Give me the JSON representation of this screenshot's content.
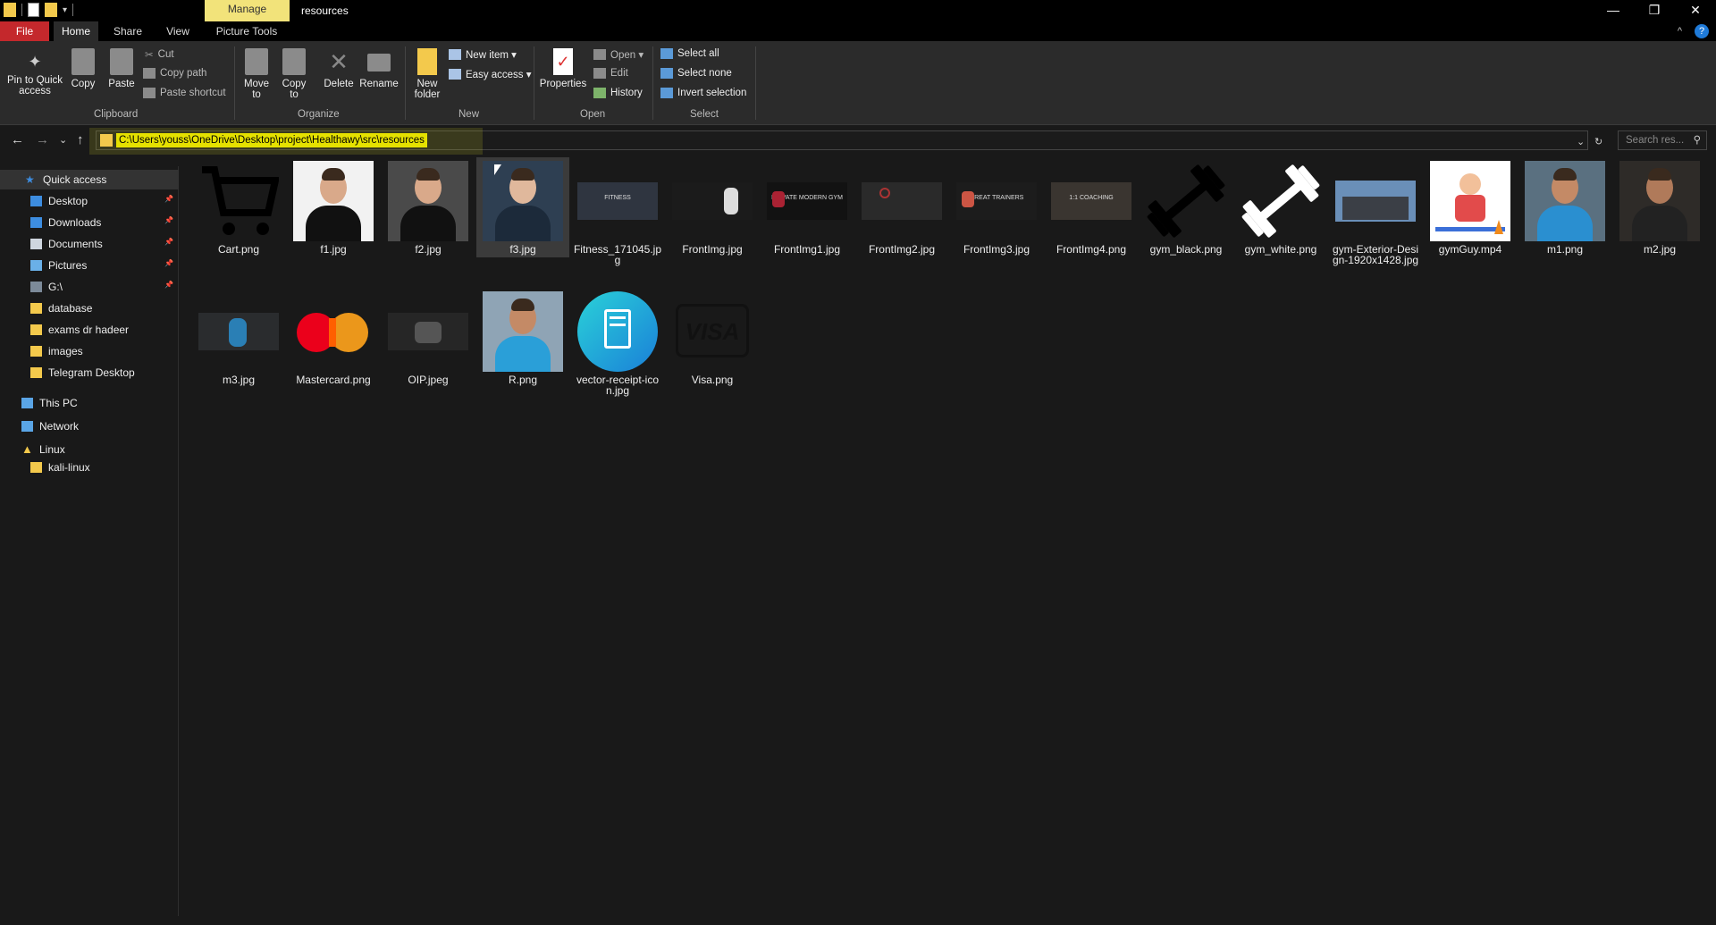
{
  "titlebar": {
    "manage_tab": "Manage",
    "title": "resources",
    "minimize": "—",
    "restore": "❐",
    "close": "✕"
  },
  "tabs": {
    "file": "File",
    "home": "Home",
    "share": "Share",
    "view": "View",
    "picture_tools": "Picture Tools",
    "expand": "^",
    "help": "?"
  },
  "ribbon": {
    "pin_quick_access": "Pin to Quick access",
    "copy": "Copy",
    "paste": "Paste",
    "cut": "Cut",
    "copy_path": "Copy path",
    "paste_shortcut": "Paste shortcut",
    "clipboard_label": "Clipboard",
    "move_to": "Move to",
    "copy_to": "Copy to",
    "delete": "Delete",
    "rename": "Rename",
    "organize_label": "Organize",
    "new_folder": "New folder",
    "new_item": "New item ▾",
    "easy_access": "Easy access ▾",
    "new_label": "New",
    "properties": "Properties",
    "open": "Open ▾",
    "edit": "Edit",
    "history": "History",
    "open_label": "Open",
    "select_all": "Select all",
    "select_none": "Select none",
    "invert_selection": "Invert selection",
    "select_label": "Select"
  },
  "address": {
    "back": "←",
    "forward": "→",
    "recent": "⌄",
    "up": "↑",
    "path": "C:\\Users\\youss\\OneDrive\\Desktop\\project\\Healthawy\\src\\resources",
    "dropdown": "⌄",
    "refresh": "↻",
    "search_placeholder": "Search res...",
    "search_icon": "⚲"
  },
  "sidebar": {
    "quick_access": "Quick access",
    "items": [
      {
        "label": "Desktop",
        "icon": "desktop-icon",
        "color": "#3d8de0",
        "pinned": true
      },
      {
        "label": "Downloads",
        "icon": "downloads-icon",
        "color": "#3d8de0",
        "pinned": true
      },
      {
        "label": "Documents",
        "icon": "documents-icon",
        "color": "#cfd6df",
        "pinned": true
      },
      {
        "label": "Pictures",
        "icon": "pictures-icon",
        "color": "#6ab0e8",
        "pinned": true
      },
      {
        "label": "G:\\",
        "icon": "drive-icon",
        "color": "#7c8a99",
        "pinned": true
      },
      {
        "label": "database",
        "icon": "folder-icon",
        "color": "#f3c94c",
        "pinned": false
      },
      {
        "label": "exams dr hadeer",
        "icon": "folder-icon",
        "color": "#f3c94c",
        "pinned": false
      },
      {
        "label": "images",
        "icon": "folder-icon",
        "color": "#f3c94c",
        "pinned": false
      },
      {
        "label": "Telegram Desktop",
        "icon": "folder-icon",
        "color": "#f3c94c",
        "pinned": false
      }
    ],
    "this_pc": "This PC",
    "network": "Network",
    "linux": "Linux",
    "kali": "kali-linux",
    "pin_glyph": "📌"
  },
  "files": [
    {
      "name": "Cart.png",
      "thumb": "cart"
    },
    {
      "name": "f1.jpg",
      "thumb": "f1"
    },
    {
      "name": "f2.jpg",
      "thumb": "f2"
    },
    {
      "name": "f3.jpg",
      "thumb": "f3",
      "selected": true
    },
    {
      "name": "Fitness_171045.jpg",
      "thumb": "fitness"
    },
    {
      "name": "FrontImg.jpg",
      "thumb": "front"
    },
    {
      "name": "FrontImg1.jpg",
      "thumb": "front1"
    },
    {
      "name": "FrontImg2.jpg",
      "thumb": "front2"
    },
    {
      "name": "FrontImg3.jpg",
      "thumb": "front3"
    },
    {
      "name": "FrontImg4.png",
      "thumb": "front4"
    },
    {
      "name": "gym_black.png",
      "thumb": "gymblack"
    },
    {
      "name": "gym_white.png",
      "thumb": "gymwhite"
    },
    {
      "name": "gym-Exterior-Design-1920x1428.jpg",
      "thumb": "exterior"
    },
    {
      "name": "gymGuy.mp4",
      "thumb": "gymguy"
    },
    {
      "name": "m1.png",
      "thumb": "m1"
    },
    {
      "name": "m2.jpg",
      "thumb": "m2"
    },
    {
      "name": "m3.jpg",
      "thumb": "m3"
    },
    {
      "name": "Mastercard.png",
      "thumb": "mastercard"
    },
    {
      "name": "OIP.jpeg",
      "thumb": "oip"
    },
    {
      "name": "R.png",
      "thumb": "r"
    },
    {
      "name": "vector-receipt-icon.jpg",
      "thumb": "receipt"
    },
    {
      "name": "Visa.png",
      "thumb": "visa"
    }
  ],
  "thumb_text": {
    "visa": "VISA",
    "front1": "PRIVATE MODERN GYM",
    "front3": "GREAT TRAINERS",
    "front4": "1:1 COACHING",
    "fitness": "FITNESS"
  }
}
